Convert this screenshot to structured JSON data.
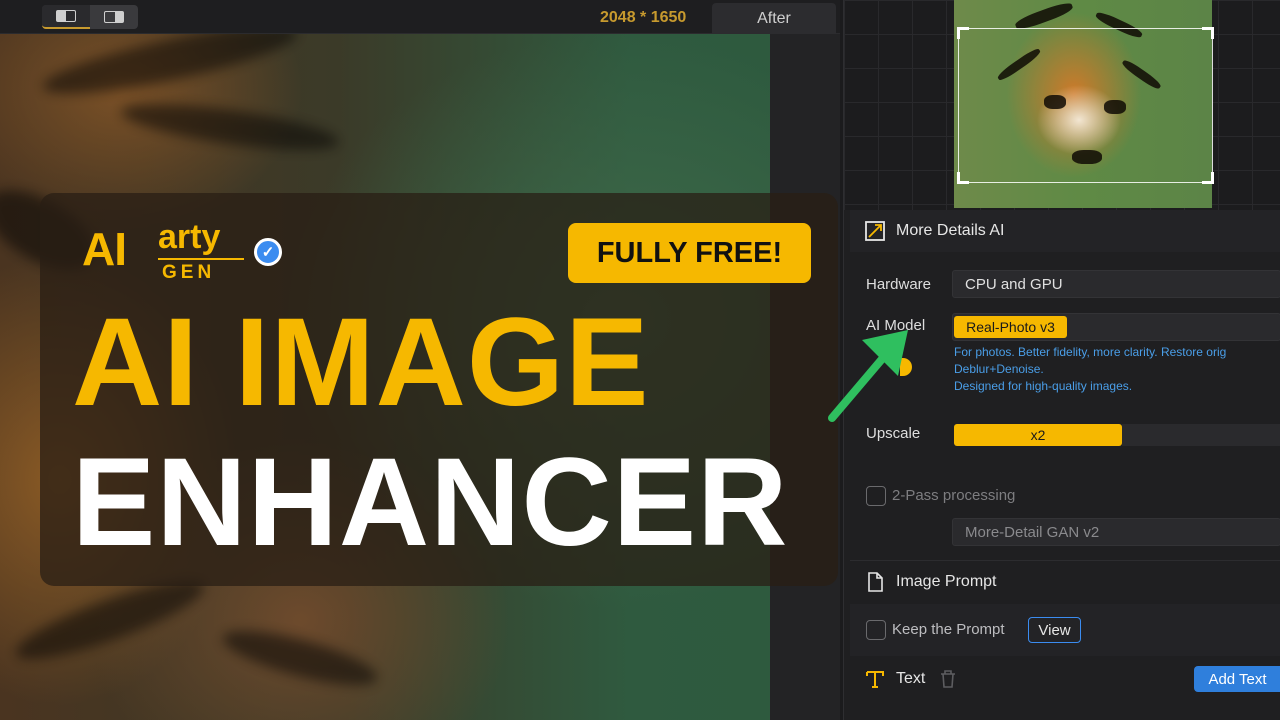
{
  "toolbar": {
    "resolution": "2048 * 1650",
    "after_tab": "After"
  },
  "promo": {
    "logo_ai": "AI",
    "logo_arty": "arty",
    "logo_gen": "GEN",
    "badge": "FULLY FREE!",
    "headline_line1": "AI IMAGE",
    "headline_line2": "ENHANCER"
  },
  "panel": {
    "more_details": {
      "title": "More Details AI",
      "hardware_label": "Hardware",
      "hardware_value": "CPU and GPU",
      "ai_model_label": "AI Model",
      "ai_model_value": "Real-Photo v3",
      "model_desc_line1": "For photos. Better fidelity, more clarity. Restore orig",
      "model_desc_line2": "Deblur+Denoise.",
      "model_desc_line3": "Designed for high-quality images.",
      "upscale_label": "Upscale",
      "upscale_value": "x2",
      "two_pass_label": "2-Pass processing",
      "two_pass_model": "More-Detail GAN v2"
    },
    "image_prompt": {
      "title": "Image Prompt",
      "keep_prompt_label": "Keep the Prompt",
      "view_button": "View"
    },
    "text_section": {
      "title": "Text",
      "add_text_button": "Add Text"
    }
  },
  "colors": {
    "accent_yellow": "#f6b800",
    "link_blue": "#4a9ee8",
    "button_blue": "#2f7fdc",
    "arrow_green": "#2fbf5f"
  }
}
